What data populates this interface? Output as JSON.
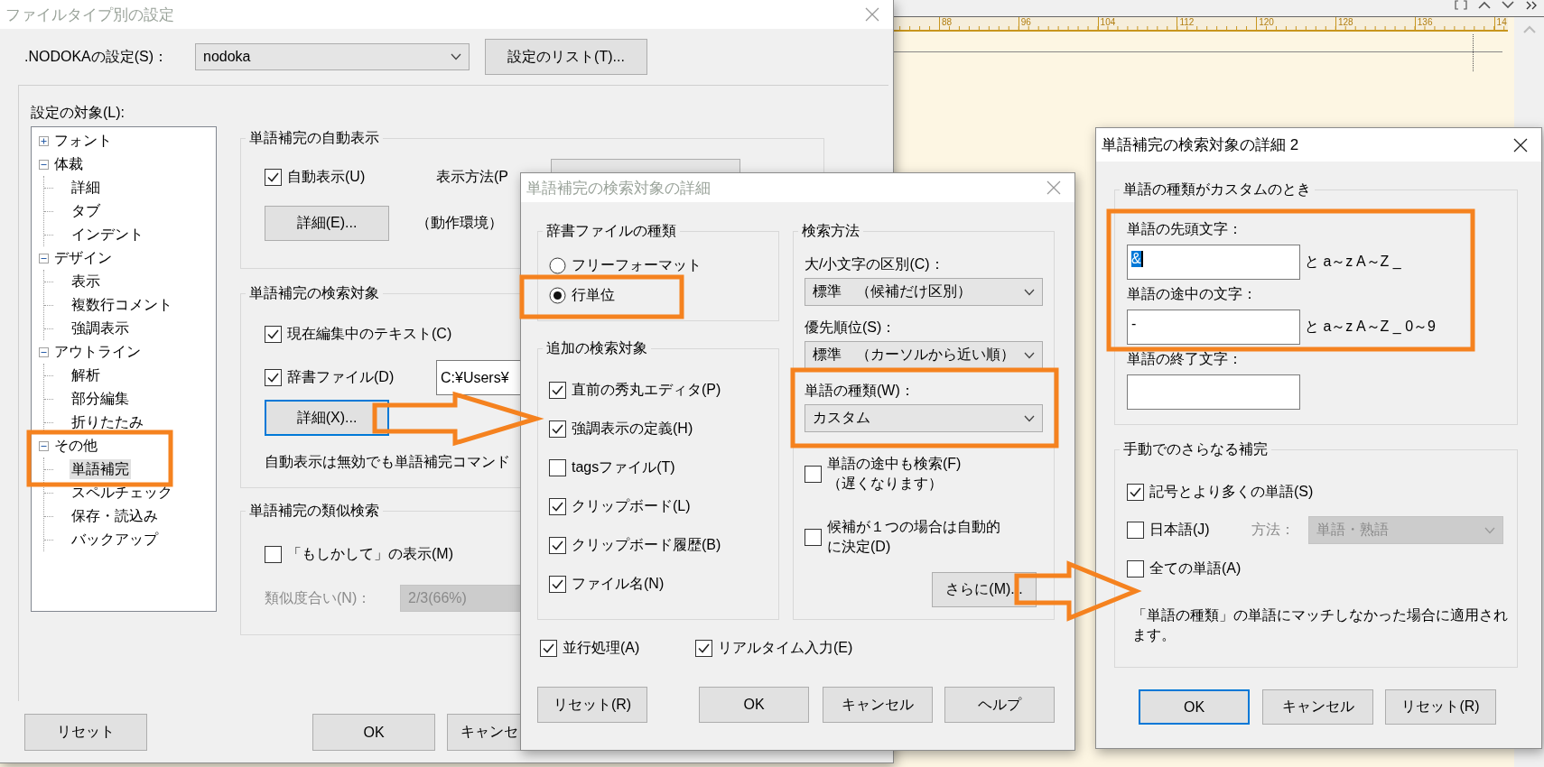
{
  "editor": {
    "ruler_labels": [
      "88",
      "96",
      "104",
      "112",
      "120",
      "128",
      "136",
      "14"
    ]
  },
  "settings_window": {
    "title": "ファイルタイプ別の設定",
    "active": false,
    "nodoka": {
      "label": ".NODOKAの設定(S)：",
      "value": "nodoka"
    },
    "list_button": "設定のリスト(T)...",
    "tree_label": "設定の対象(L):",
    "tree": [
      {
        "label": "フォント",
        "expanded": false,
        "selected": false
      },
      {
        "label": "体裁",
        "expanded": true,
        "selected": false,
        "children": [
          {
            "label": "詳細",
            "selected": false
          },
          {
            "label": "タブ",
            "selected": false
          },
          {
            "label": "インデント",
            "selected": false
          }
        ]
      },
      {
        "label": "デザイン",
        "expanded": true,
        "selected": false,
        "children": [
          {
            "label": "表示",
            "selected": false
          },
          {
            "label": "複数行コメント",
            "selected": false
          },
          {
            "label": "強調表示",
            "selected": false
          }
        ]
      },
      {
        "label": "アウトライン",
        "expanded": true,
        "selected": false,
        "children": [
          {
            "label": "解析",
            "selected": false
          },
          {
            "label": "部分編集",
            "selected": false
          },
          {
            "label": "折りたたみ",
            "selected": false
          }
        ]
      },
      {
        "label": "その他",
        "expanded": true,
        "selected": false,
        "children": [
          {
            "label": "単語補完",
            "selected": true
          },
          {
            "label": "スペルチェック",
            "selected": false
          },
          {
            "label": "保存・読込み",
            "selected": false
          },
          {
            "label": "バックアップ",
            "selected": false
          }
        ]
      }
    ],
    "auto_group": {
      "title": "単語補完の自動表示",
      "auto_display": {
        "label": "自動表示(U)",
        "checked": true
      },
      "method_label": "表示方法(P",
      "detail_button": {
        "label": "詳細(E)...",
        "focused": false
      },
      "note": "（動作環境）"
    },
    "search_group": {
      "title": "単語補完の検索対象",
      "checks": [
        {
          "label": "現在編集中のテキスト(C)",
          "checked": true
        },
        {
          "label": "辞書ファイル(D)",
          "checked": true
        }
      ],
      "dict_path": "C:¥Users¥",
      "detail_button": {
        "label": "詳細(X)...",
        "focused": true
      },
      "note": "自動表示は無効でも単語補完コマンド"
    },
    "similar_group": {
      "title": "単語補完の類似検索",
      "check": {
        "label": "「もしかして」の表示(M)",
        "checked": false
      },
      "degree": {
        "label": "類似度合い(N)：",
        "value": "2/3(66%)",
        "disabled": true
      }
    },
    "buttons": [
      "リセット",
      "OK",
      "キャンセ"
    ]
  },
  "detail_dialog": {
    "title": "単語補完の検索対象の詳細",
    "active": false,
    "dict_type": {
      "title": "辞書ファイルの種類",
      "options": [
        {
          "label": "フリーフォーマット",
          "selected": false
        },
        {
          "label": "行単位",
          "selected": true
        }
      ]
    },
    "extra_targets": {
      "title": "追加の検索対象",
      "items": [
        {
          "label": "直前の秀丸エディタ(P)",
          "checked": true
        },
        {
          "label": "強調表示の定義(H)",
          "checked": true
        },
        {
          "label": "tagsファイル(T)",
          "checked": false
        },
        {
          "label": "クリップボード(L)",
          "checked": true
        },
        {
          "label": "クリップボード履歴(B)",
          "checked": true
        },
        {
          "label": "ファイル名(N)",
          "checked": true
        }
      ]
    },
    "search_method": {
      "title": "検索方法",
      "fields": [
        {
          "label": "大/小文字の区別(C)：",
          "value": "標準　（候補だけ区別）"
        },
        {
          "label": "優先順位(S)：",
          "value": "標準　（カーソルから近い順）"
        },
        {
          "label": "単語の種類(W)：",
          "value": "カスタム"
        }
      ],
      "options": [
        {
          "label": "単語の途中も検索(F)",
          "note": "（遅くなります）",
          "checked": false
        },
        {
          "label": "候補が１つの場合は自動的に決定(D)",
          "checked": false
        }
      ],
      "more_button": "さらに(M)..."
    },
    "bottom_checks": [
      {
        "label": "並行処理(A)",
        "checked": true
      },
      {
        "label": "リアルタイム入力(E)",
        "checked": true
      }
    ],
    "buttons": [
      "リセット(R)",
      "OK",
      "キャンセル",
      "ヘルプ"
    ]
  },
  "detail2_dialog": {
    "title": "単語補完の検索対象の詳細 2",
    "active": true,
    "custom_group": {
      "title": "単語の種類がカスタムのとき",
      "fields": [
        {
          "label": "単語の先頭文字：",
          "value": "&",
          "highlighted": true,
          "suffix": "と a～z A～Z _"
        },
        {
          "label": "単語の途中の文字：",
          "value": "-",
          "highlighted": false,
          "suffix": "と a～z A～Z _ 0～9"
        },
        {
          "label": "単語の終了文字："
        }
      ]
    },
    "manual_group": {
      "title": "手動でのさらなる補完",
      "options": [
        {
          "label": "記号とより多くの単語(S)",
          "checked": true
        },
        {
          "label": "日本語(J)",
          "checked": false,
          "method": {
            "label": "方法：",
            "value": "単語・熟語",
            "disabled": true
          }
        },
        {
          "label": "全ての単語(A)",
          "checked": false
        }
      ],
      "note": "「単語の種類」の単語にマッチしなかった場合に適用されます。"
    },
    "buttons": [
      {
        "label": "OK",
        "focused": true
      },
      {
        "label": "キャンセル",
        "focused": false
      },
      {
        "label": "リセット(R)",
        "focused": false
      }
    ]
  }
}
